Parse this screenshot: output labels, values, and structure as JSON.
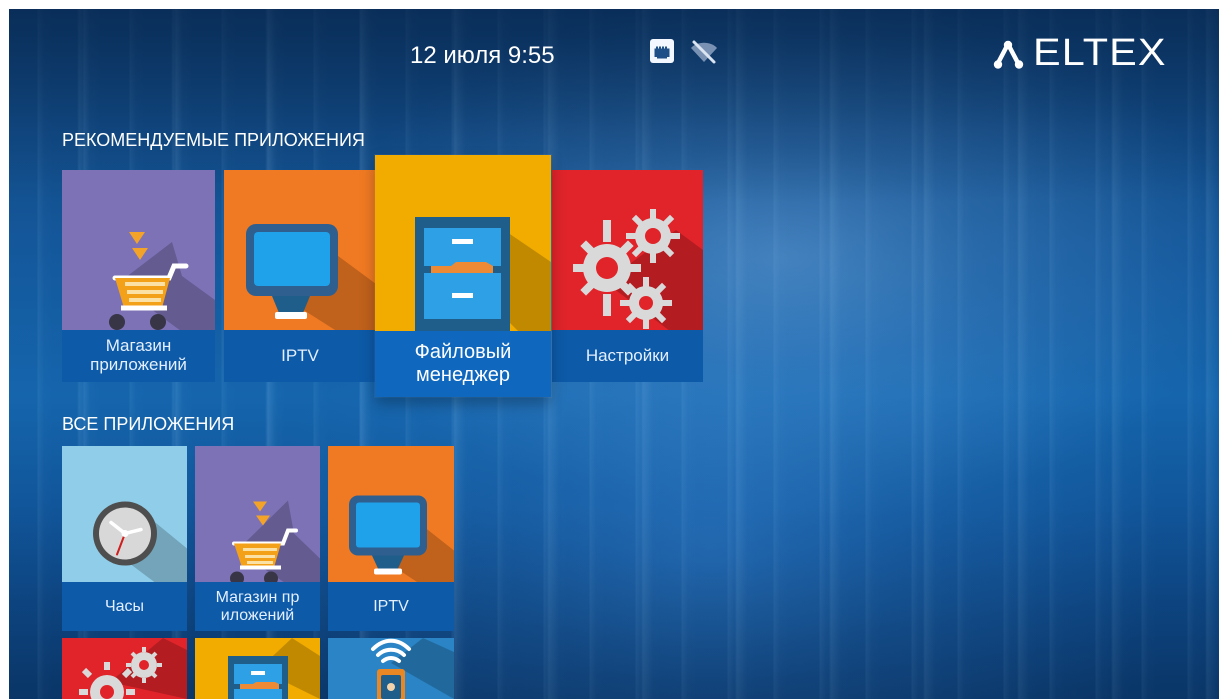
{
  "status": {
    "date_time": "12 июля 9:55",
    "ethernet_icon": "ethernet-connected-icon",
    "wifi_icon": "wifi-off-icon"
  },
  "brand": {
    "name": "ELTEX",
    "logo_icon": "eltex-logo-icon"
  },
  "sections": {
    "recommended_title": "РЕКОМЕНДУЕМЫЕ ПРИЛОЖЕНИЯ",
    "all_title": "ВСЕ ПРИЛОЖЕНИЯ"
  },
  "recommended_apps": [
    {
      "label": "Магазин приложений",
      "icon": "shopping-cart-icon",
      "color": "#7d72b6"
    },
    {
      "label": "IPTV",
      "icon": "monitor-icon",
      "color": "#f07a23"
    },
    {
      "label": "Файловый менеджер",
      "icon": "file-cabinet-icon",
      "color": "#f2ac00",
      "focused": true
    },
    {
      "label": "Настройки",
      "icon": "gears-icon",
      "color": "#e0242a"
    }
  ],
  "all_apps": [
    {
      "label": "Часы",
      "icon": "clock-icon",
      "color": "#90cde8"
    },
    {
      "label": "Магазин пр иложений",
      "icon": "shopping-cart-icon",
      "color": "#7d72b6"
    },
    {
      "label": "IPTV",
      "icon": "monitor-icon",
      "color": "#f07a23"
    },
    {
      "label": "",
      "icon": "gears-icon",
      "color": "#e0242a"
    },
    {
      "label": "",
      "icon": "file-cabinet-icon",
      "color": "#f2ac00"
    },
    {
      "label": "",
      "icon": "wifi-remote-icon",
      "color": "#2a84c5"
    }
  ],
  "colors": {
    "label_bar": "#0d5aa8",
    "focused_label_bar": "#0f67be",
    "text": "#ffffff"
  }
}
